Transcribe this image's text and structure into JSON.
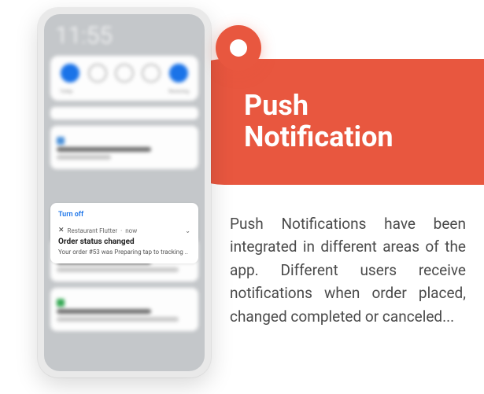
{
  "banner": {
    "title_line1": "Push",
    "title_line2": "Notification"
  },
  "description": "Push Notifications have been integrated in different areas of the app. Different users receive notifications when order placed, changed completed or canceled...",
  "phone": {
    "clock": "11:55",
    "qs_sub_left": "Today",
    "qs_sub_right": "Receiving",
    "notif1": {
      "app": "Android System",
      "title": "Tethering or hotspot active",
      "sub": "Tap to set up"
    },
    "sharp": {
      "link": "Turn off",
      "app": "Restaurant Flutter",
      "time": "now",
      "title": "Order status changed",
      "body": "Your order #53 was Preparing tap to tracking .."
    },
    "notif2": {
      "app": "Android System",
      "title": "USB tethering turned on"
    },
    "notif3": {
      "app": "Android System",
      "title": "USB debugging connected"
    }
  }
}
